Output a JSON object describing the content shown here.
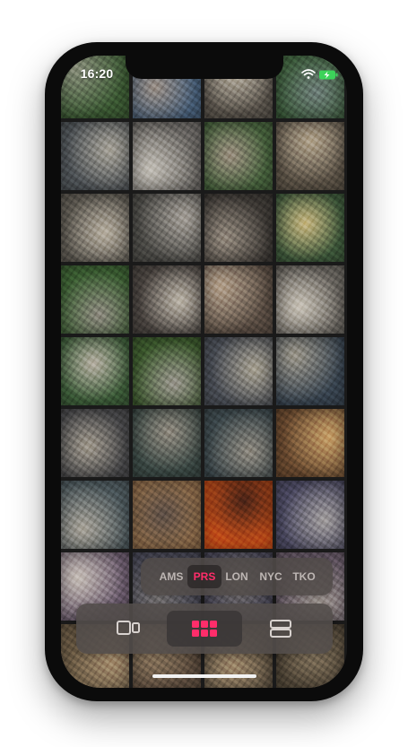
{
  "status_bar": {
    "time": "16:20",
    "icons": [
      "signal-icon",
      "wifi-icon",
      "battery-charging-icon"
    ]
  },
  "photo_grid": {
    "tiles": [
      {
        "a": "#3c5a34",
        "b": "#8a8f7c"
      },
      {
        "a": "#49607a",
        "b": "#9a8f86"
      },
      {
        "a": "#5a544c",
        "b": "#b9b1a2"
      },
      {
        "a": "#3b5a3a",
        "b": "#6f7f7a"
      },
      {
        "a": "#4f5458",
        "b": "#a8a49a"
      },
      {
        "a": "#6d6a66",
        "b": "#c4c0b8"
      },
      {
        "a": "#47623d",
        "b": "#9b8f80"
      },
      {
        "a": "#5c5347",
        "b": "#b3a58e"
      },
      {
        "a": "#5e5a52",
        "b": "#b8b0a2"
      },
      {
        "a": "#4d4c48",
        "b": "#a6a19a"
      },
      {
        "a": "#3e3a36",
        "b": "#948a7e"
      },
      {
        "a": "#3f5a3c",
        "b": "#c9b883"
      },
      {
        "a": "#3d6034",
        "b": "#8e8a80"
      },
      {
        "a": "#4a4440",
        "b": "#bdb6aa"
      },
      {
        "a": "#5b4e44",
        "b": "#b6a38e"
      },
      {
        "a": "#6a6660",
        "b": "#c9c3b8"
      },
      {
        "a": "#3e5e3a",
        "b": "#b7b0a4"
      },
      {
        "a": "#3d5a2e",
        "b": "#9a968e"
      },
      {
        "a": "#4a4e56",
        "b": "#a9a394"
      },
      {
        "a": "#3a4652",
        "b": "#9d988c"
      },
      {
        "a": "#4a4a4c",
        "b": "#a19a8e"
      },
      {
        "a": "#3c4a46",
        "b": "#918b80"
      },
      {
        "a": "#3e4a4e",
        "b": "#8f8a80"
      },
      {
        "a": "#6a4a30",
        "b": "#c9a26a"
      },
      {
        "a": "#4e5a5e",
        "b": "#a9a49a"
      },
      {
        "a": "#8a6a4a",
        "b": "#5e5048"
      },
      {
        "a": "#c8501a",
        "b": "#4a2418"
      },
      {
        "a": "#4c4a62",
        "b": "#a29e9e"
      },
      {
        "a": "#6e5e70",
        "b": "#c7bfb8"
      },
      {
        "a": "#4a4a58",
        "b": "#7e7a7a"
      },
      {
        "a": "#4e4c5c",
        "b": "#8a8480"
      },
      {
        "a": "#6a5c6a",
        "b": "#a8a09a"
      },
      {
        "a": "#6a5a44",
        "b": "#a89070"
      },
      {
        "a": "#5a4a3c",
        "b": "#9a8468"
      },
      {
        "a": "#5c5040",
        "b": "#a08a6c"
      },
      {
        "a": "#4e4436",
        "b": "#8a7a62"
      }
    ]
  },
  "city_selector": {
    "items": [
      {
        "label": "AMS",
        "active": false
      },
      {
        "label": "PRS",
        "active": true
      },
      {
        "label": "LON",
        "active": false
      },
      {
        "label": "NYC",
        "active": false
      },
      {
        "label": "TKO",
        "active": false
      }
    ],
    "active_color": "#ff2d6a",
    "inactive_color": "#bdb6b3"
  },
  "view_mode_bar": {
    "buttons": [
      {
        "icon": "split-view-icon",
        "active": false
      },
      {
        "icon": "grid-view-icon",
        "active": true
      },
      {
        "icon": "list-view-icon",
        "active": false
      }
    ],
    "active_color": "#ff2d6a",
    "inactive_color": "#d8d2cf"
  }
}
